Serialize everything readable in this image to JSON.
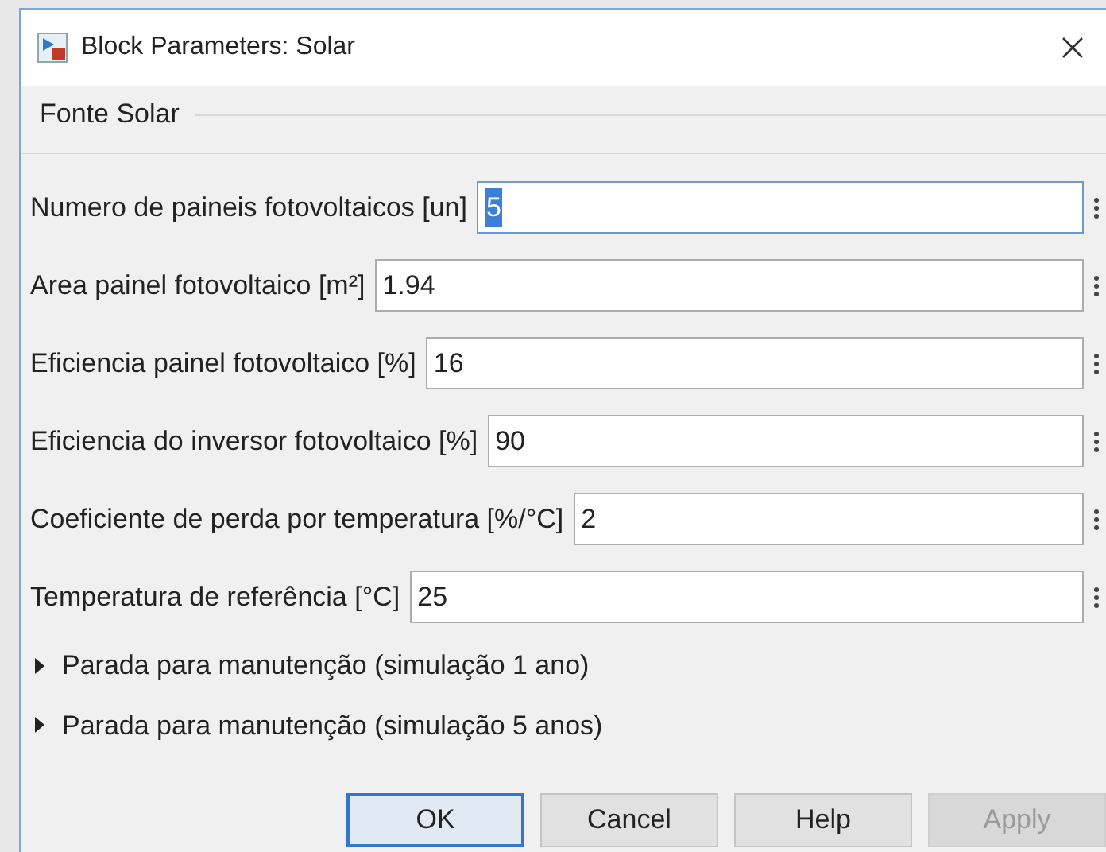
{
  "window": {
    "title": "Block Parameters: Solar"
  },
  "group": {
    "title": "Fonte Solar"
  },
  "parameters": [
    {
      "label": "Numero de paineis fotovoltaicos [un]",
      "value": "5",
      "focused": true
    },
    {
      "label": "Area painel fotovoltaico [m²]",
      "value": "1.94",
      "focused": false
    },
    {
      "label": "Eficiencia painel fotovoltaico [%]",
      "value": "16",
      "focused": false
    },
    {
      "label": "Eficiencia do inversor fotovoltaico [%]",
      "value": "90",
      "focused": false
    },
    {
      "label": "Coeficiente de perda por temperatura [%/°C]",
      "value": "2",
      "focused": false
    },
    {
      "label": "Temperatura de referência [°C]",
      "value": "25",
      "focused": false
    }
  ],
  "sections": [
    {
      "label": "Parada para manutenção (simulação 1 ano)",
      "expanded": false
    },
    {
      "label": "Parada para manutenção (simulação 5 anos)",
      "expanded": false
    }
  ],
  "buttons": [
    {
      "label": "OK",
      "default": true,
      "disabled": false
    },
    {
      "label": "Cancel",
      "default": false,
      "disabled": false
    },
    {
      "label": "Help",
      "default": false,
      "disabled": false
    },
    {
      "label": "Apply",
      "default": false,
      "disabled": true
    }
  ]
}
